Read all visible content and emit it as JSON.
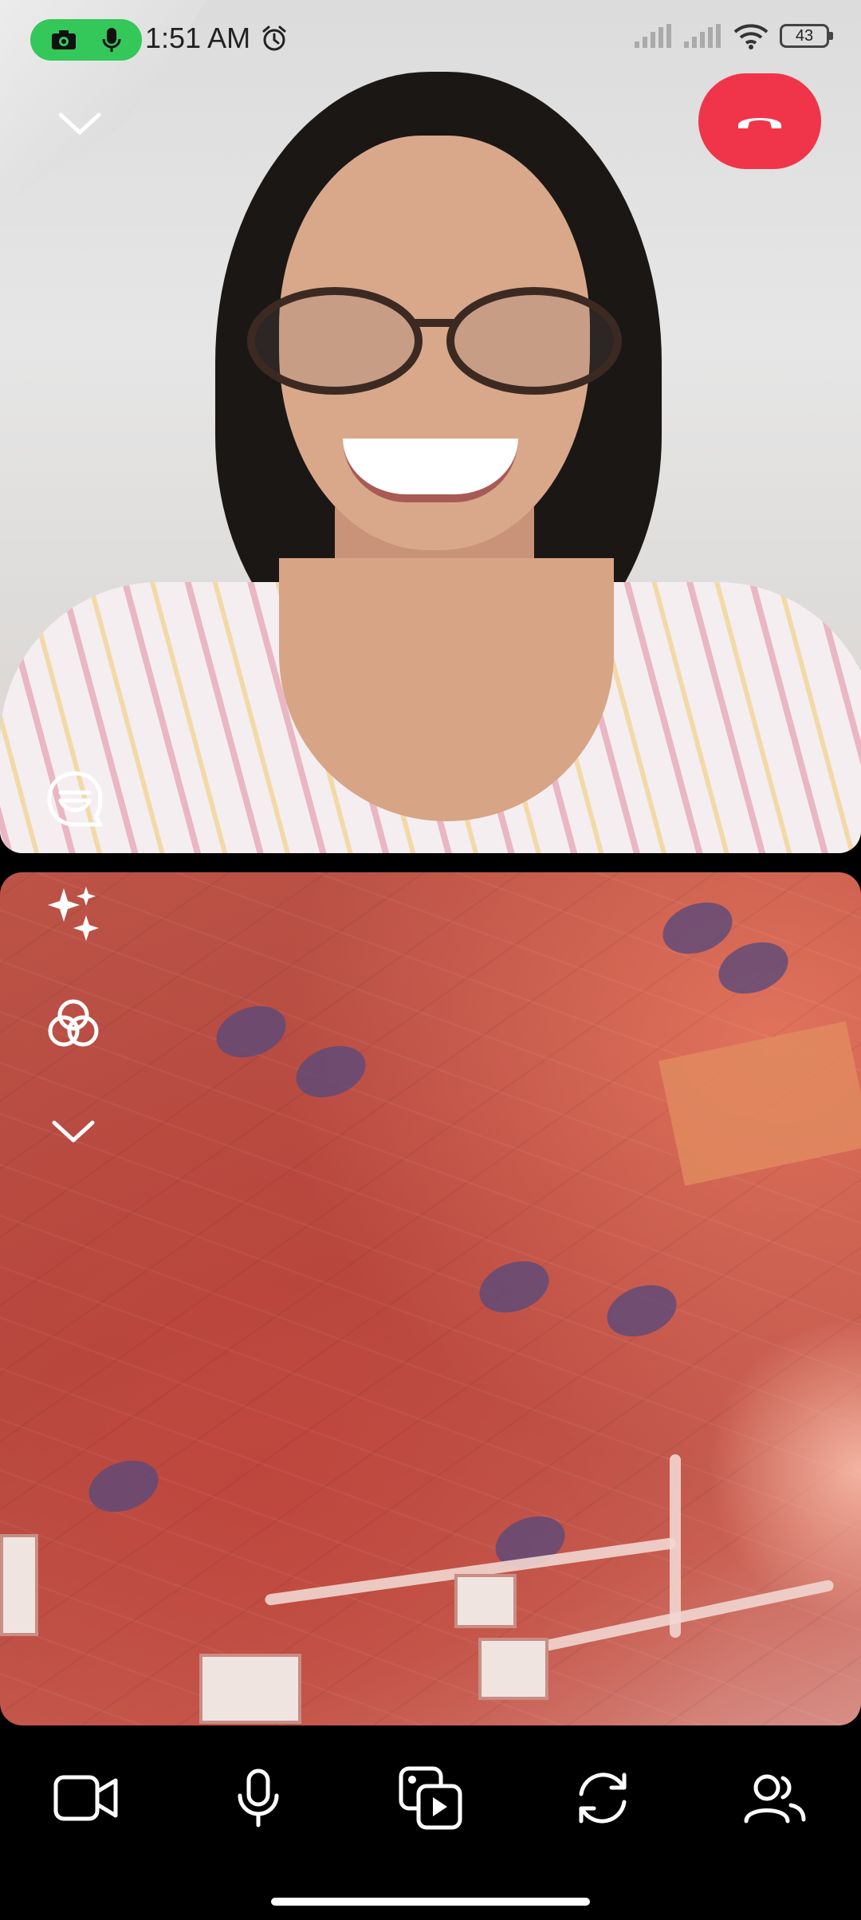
{
  "status_bar": {
    "time": "1:51 AM",
    "battery": "43",
    "icons": [
      "camera-icon",
      "mic-icon",
      "alarm-icon",
      "signal-icon",
      "signal-icon",
      "wifi-icon",
      "battery-icon"
    ],
    "pill_color": "#34c759"
  },
  "call": {
    "end_call_color": "#f0354a",
    "top_controls": [
      "chevron-down-icon",
      "end-call-icon"
    ],
    "remote_tile_controls": [
      "chat-bubble-icon"
    ],
    "self_tile_controls": [
      "sparkles-icon",
      "filters-icon",
      "chevron-down-icon"
    ]
  },
  "toolbar": {
    "items": [
      "video-camera-icon",
      "microphone-icon",
      "media-share-icon",
      "flip-camera-icon",
      "participants-icon"
    ]
  }
}
